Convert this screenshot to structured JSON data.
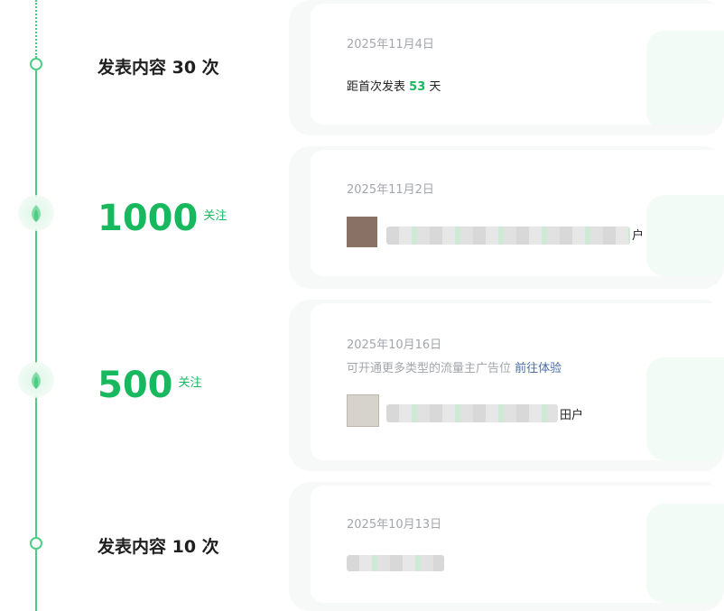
{
  "milestones": [
    {
      "type": "text",
      "label": "发表内容 30 次"
    },
    {
      "type": "big",
      "number": "1000",
      "unit": "关注"
    },
    {
      "type": "big",
      "number": "500",
      "unit": "关注"
    },
    {
      "type": "text",
      "label": "发表内容 10 次"
    }
  ],
  "cards": [
    {
      "date": "2025年11月4日",
      "line_prefix": "距首次发表",
      "line_number": "53",
      "line_suffix": "天"
    },
    {
      "date": "2025年11月2日",
      "content_suffix": "户"
    },
    {
      "date": "2025年10月16日",
      "promo_text": "可开通更多类型的流量主广告位",
      "promo_link": "前往体验",
      "content_suffix": "田户"
    },
    {
      "date": "2025年10月13日"
    }
  ],
  "colors": {
    "accent": "#17b85e",
    "timeline": "#4ecb84",
    "muted": "#a3a6ab",
    "link": "#4a6fa8"
  }
}
